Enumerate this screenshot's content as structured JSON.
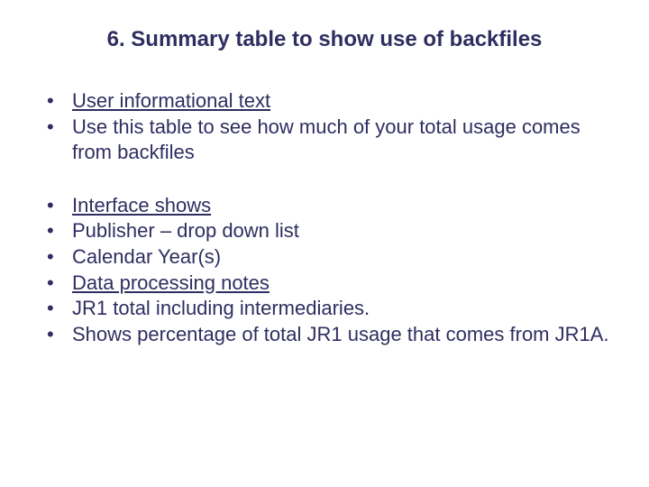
{
  "title": "6. Summary table to show use of backfiles",
  "group1": {
    "item1": "User informational text",
    "item2": "Use this table to see how much of your total usage comes from backfiles"
  },
  "group2": {
    "item1": "Interface shows",
    "item2": "Publisher – drop down list",
    "item3": "Calendar Year(s)",
    "item4": "Data processing notes",
    "item5": "JR1 total including intermediaries.",
    "item6": "Shows percentage of total JR1 usage that comes from JR1A."
  }
}
